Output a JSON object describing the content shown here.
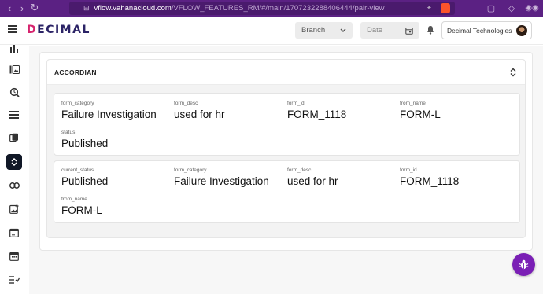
{
  "browser": {
    "url_host": "vflow.vahanacloud.com",
    "url_path": "/VFLOW_FEATURES_RM/#/main/1707232288406444/pair-view"
  },
  "header": {
    "logo_main": "ECIMAL",
    "logo_accent": "D",
    "branch_placeholder": "Branch",
    "date_placeholder": "Date",
    "company_name": "Decimal Technologies"
  },
  "accordion": {
    "title": "ACCORDIAN",
    "records": [
      {
        "row1": [
          {
            "label": "form_category",
            "value": "Failure Investigation"
          },
          {
            "label": "form_desc",
            "value": "used for hr"
          },
          {
            "label": "form_id",
            "value": "FORM_1118"
          },
          {
            "label": "from_name",
            "value": "FORM-L"
          }
        ],
        "row2": [
          {
            "label": "status",
            "value": "Published"
          }
        ]
      },
      {
        "row1": [
          {
            "label": "current_status",
            "value": "Published"
          },
          {
            "label": "form_category",
            "value": "Failure Investigation"
          },
          {
            "label": "form_desc",
            "value": "used for hr"
          },
          {
            "label": "form_id",
            "value": "FORM_1118"
          }
        ],
        "row2": [
          {
            "label": "from_name",
            "value": "FORM-L"
          }
        ]
      }
    ]
  },
  "colors": {
    "browser_bar": "#5b2183",
    "logo_primary": "#2b2366",
    "logo_accent": "#d6246e",
    "sidebar_active": "#111827",
    "fab": "#7a1fb5"
  },
  "icons": {
    "sidebar": [
      "bar-chart-icon",
      "gallery-icon",
      "search-history-icon",
      "list-icon",
      "copy-pages-icon",
      "accordion-icon",
      "link-icon",
      "add-image-icon",
      "calendar-list-icon",
      "calendar-icon",
      "checklist-icon"
    ],
    "fab": "bug-icon"
  }
}
